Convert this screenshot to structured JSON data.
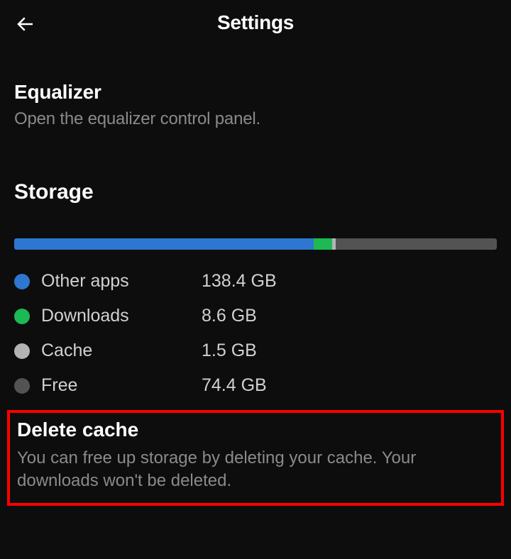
{
  "header": {
    "title": "Settings"
  },
  "equalizer": {
    "title": "Equalizer",
    "subtitle": "Open the equalizer control panel."
  },
  "storage": {
    "heading": "Storage",
    "total_gb": 222.9,
    "segments": [
      {
        "key": "other_apps",
        "label": "Other apps",
        "value": "138.4 GB",
        "gb": 138.4,
        "color": "#2e77d0"
      },
      {
        "key": "downloads",
        "label": "Downloads",
        "value": "8.6 GB",
        "gb": 8.6,
        "color": "#1db954"
      },
      {
        "key": "cache",
        "label": "Cache",
        "value": "1.5 GB",
        "gb": 1.5,
        "color": "#b3b3b3"
      },
      {
        "key": "free",
        "label": "Free",
        "value": "74.4 GB",
        "gb": 74.4,
        "color": "#535353"
      }
    ]
  },
  "delete_cache": {
    "title": "Delete cache",
    "subtitle": "You can free up storage by deleting your cache. Your downloads won't be deleted."
  }
}
